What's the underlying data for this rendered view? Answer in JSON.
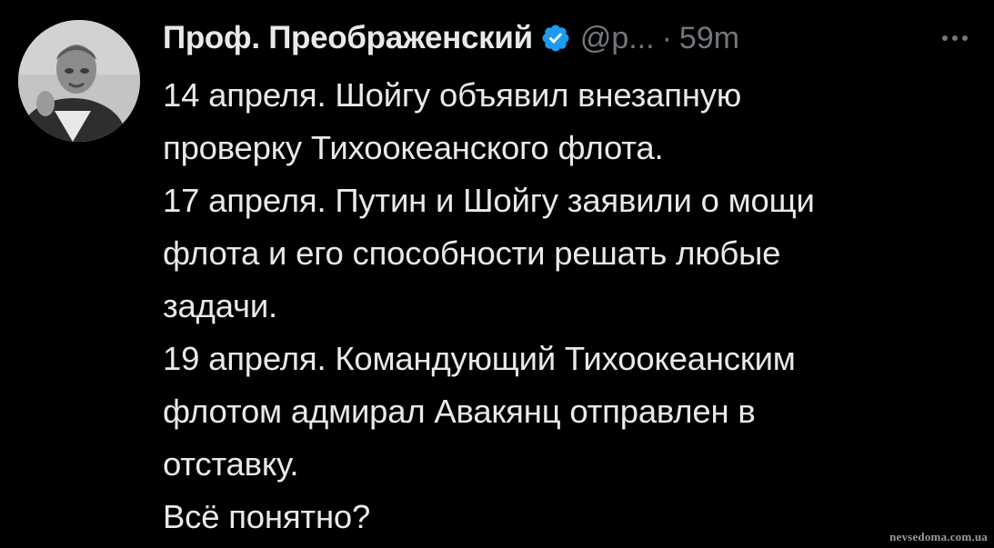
{
  "post": {
    "author": {
      "display_name": "Проф. Преображенский",
      "handle": "@p...",
      "verified_icon": "verified-badge-icon",
      "avatar_icon": "avatar-photo"
    },
    "separator": "·",
    "time": "59m",
    "more_icon": "more-options-icon",
    "lines": [
      "14 апреля. Шойгу объявил внезапную",
      "проверку Тихоокеанского флота.",
      "17 апреля. Путин и Шойгу заявили о мощи",
      "флота и его способности решать любые",
      "задачи.",
      "19 апреля. Командующий Тихоокеанским",
      "флотом адмирал Авакянц отправлен в",
      "отставку.",
      "Всё понятно?"
    ]
  },
  "watermark": "nevsedoma.com.ua",
  "colors": {
    "background": "#000000",
    "text": "#e7e9ea",
    "secondary_text": "#71767b",
    "verified_badge": "#1d9bf0"
  }
}
